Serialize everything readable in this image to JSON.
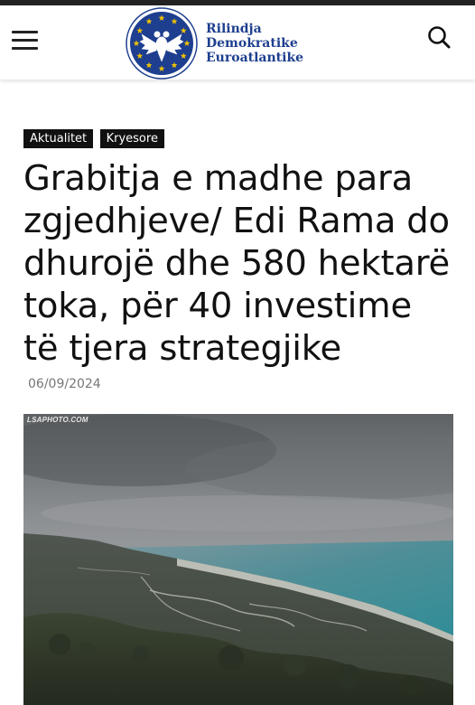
{
  "header": {
    "menu_icon": "hamburger-icon",
    "search_icon": "search-icon",
    "logo": {
      "line1": "Rilindja",
      "line2": "Demokratike",
      "line3": "Euroatlantike",
      "brand_color": "#1e3f8f",
      "star_color": "#f2c200"
    }
  },
  "article": {
    "tags": [
      "Aktualitet",
      "Kryesore"
    ],
    "title": "Grabitja e madhe para zgjedhjeve/ Edi Rama do dhurojë dhe 580 hektarë toka, për 40 investime të tjera strategjike",
    "date": "06/09/2024",
    "image": {
      "watermark": "LSAPHOTO.COM"
    }
  }
}
